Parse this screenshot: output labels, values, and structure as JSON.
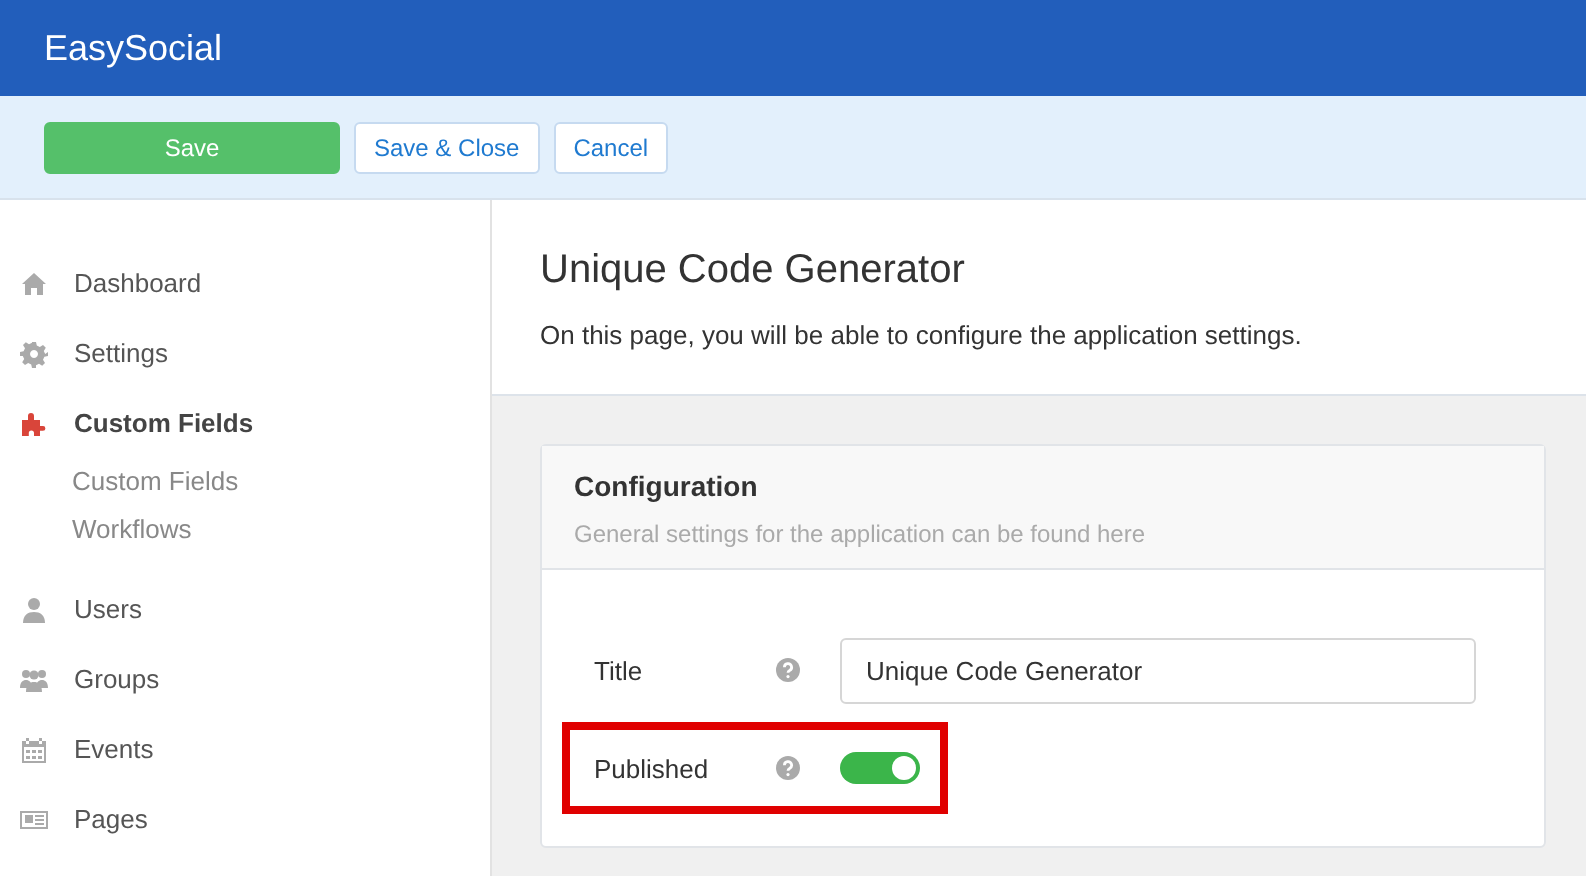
{
  "header": {
    "title": "EasySocial"
  },
  "toolbar": {
    "buttons": [
      {
        "label": "Save",
        "kind": "primary"
      },
      {
        "label": "Save & Close",
        "kind": "default"
      },
      {
        "label": "Cancel",
        "kind": "default"
      }
    ]
  },
  "sidebar": {
    "items": [
      {
        "label": "Dashboard",
        "selected": false
      },
      {
        "label": "Settings",
        "selected": false
      },
      {
        "label": "Custom Fields",
        "selected": true,
        "children": [
          {
            "label": "Custom Fields"
          },
          {
            "label": "Workflows"
          }
        ]
      },
      {
        "label": "Users",
        "selected": false
      },
      {
        "label": "Groups",
        "selected": false
      },
      {
        "label": "Events",
        "selected": false
      },
      {
        "label": "Pages",
        "selected": false
      }
    ]
  },
  "page": {
    "title": "Unique Code Generator",
    "description": "On this page, you will be able to configure the application settings."
  },
  "panel": {
    "title": "Configuration",
    "subtitle": "General settings for the application can be found here",
    "fields": [
      {
        "label": "Title",
        "kind": "text",
        "value": "Unique Code Generator",
        "highlighted": false
      },
      {
        "label": "Published",
        "kind": "toggle",
        "on": true,
        "highlighted": true
      }
    ]
  }
}
